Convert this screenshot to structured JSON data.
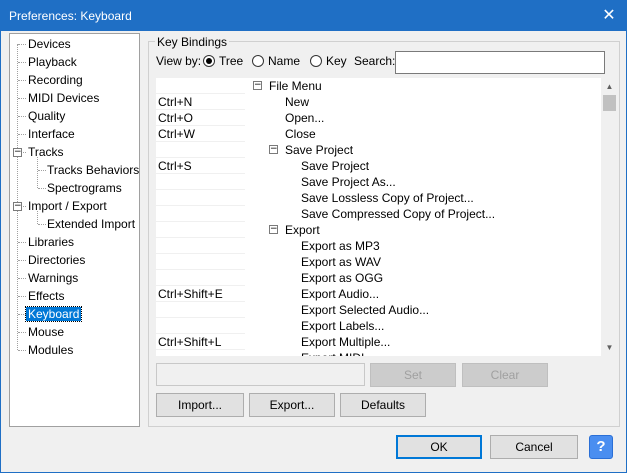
{
  "window": {
    "title": "Preferences: Keyboard",
    "close_glyph": "✕"
  },
  "tree": {
    "items": [
      {
        "label": "Devices",
        "level": 0
      },
      {
        "label": "Playback",
        "level": 0
      },
      {
        "label": "Recording",
        "level": 0
      },
      {
        "label": "MIDI Devices",
        "level": 0
      },
      {
        "label": "Quality",
        "level": 0
      },
      {
        "label": "Interface",
        "level": 0
      },
      {
        "label": "Tracks",
        "level": 0,
        "expanded": true
      },
      {
        "label": "Tracks Behaviors",
        "level": 1
      },
      {
        "label": "Spectrograms",
        "level": 1
      },
      {
        "label": "Import / Export",
        "level": 0,
        "expanded": true
      },
      {
        "label": "Extended Import",
        "level": 1
      },
      {
        "label": "Libraries",
        "level": 0
      },
      {
        "label": "Directories",
        "level": 0
      },
      {
        "label": "Warnings",
        "level": 0
      },
      {
        "label": "Effects",
        "level": 0
      },
      {
        "label": "Keyboard",
        "level": 0,
        "selected": true
      },
      {
        "label": "Mouse",
        "level": 0
      },
      {
        "label": "Modules",
        "level": 0
      }
    ],
    "expander_minus": "−"
  },
  "key_bindings": {
    "group_label": "Key Bindings",
    "view_by_label": "View by:",
    "view_by_options": [
      {
        "label": "Tree",
        "selected": true
      },
      {
        "label": "Name",
        "selected": false
      },
      {
        "label": "Key",
        "selected": false
      }
    ],
    "search_label": "Search:",
    "search_value": "",
    "rows": [
      {
        "key": "",
        "command": "File Menu",
        "depth": 0,
        "expandable": true
      },
      {
        "key": "Ctrl+N",
        "command": "New",
        "depth": 1
      },
      {
        "key": "Ctrl+O",
        "command": "Open...",
        "depth": 1
      },
      {
        "key": "Ctrl+W",
        "command": "Close",
        "depth": 1
      },
      {
        "key": "",
        "command": "Save Project",
        "depth": 1,
        "expandable": true
      },
      {
        "key": "Ctrl+S",
        "command": "Save Project",
        "depth": 2
      },
      {
        "key": "",
        "command": "Save Project As...",
        "depth": 2
      },
      {
        "key": "",
        "command": "Save Lossless Copy of Project...",
        "depth": 2
      },
      {
        "key": "",
        "command": "Save Compressed Copy of Project...",
        "depth": 2
      },
      {
        "key": "",
        "command": "Export",
        "depth": 1,
        "expandable": true
      },
      {
        "key": "",
        "command": "Export as MP3",
        "depth": 2
      },
      {
        "key": "",
        "command": "Export as WAV",
        "depth": 2
      },
      {
        "key": "",
        "command": "Export as OGG",
        "depth": 2
      },
      {
        "key": "Ctrl+Shift+E",
        "command": "Export Audio...",
        "depth": 2
      },
      {
        "key": "",
        "command": "Export Selected Audio...",
        "depth": 2
      },
      {
        "key": "",
        "command": "Export Labels...",
        "depth": 2
      },
      {
        "key": "Ctrl+Shift+L",
        "command": "Export Multiple...",
        "depth": 2
      },
      {
        "key": "",
        "command": "Export MIDI...",
        "depth": 2
      }
    ],
    "key_field_value": "",
    "set_label": "Set",
    "clear_label": "Clear",
    "import_label": "Import...",
    "export_label": "Export...",
    "defaults_label": "Defaults"
  },
  "footer": {
    "ok_label": "OK",
    "cancel_label": "Cancel",
    "help_glyph": "?"
  }
}
